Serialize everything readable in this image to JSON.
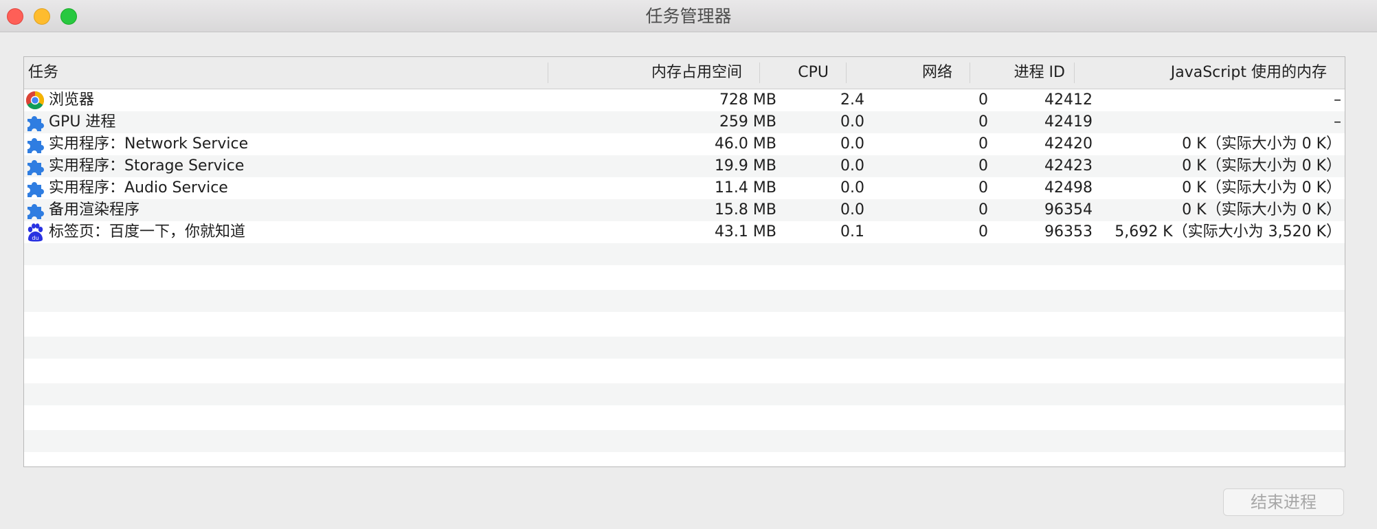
{
  "window": {
    "title": "任务管理器"
  },
  "table": {
    "columns": [
      {
        "key": "task",
        "label": "任务"
      },
      {
        "key": "memory",
        "label": "内存占用空间"
      },
      {
        "key": "cpu",
        "label": "CPU"
      },
      {
        "key": "network",
        "label": "网络"
      },
      {
        "key": "pid",
        "label": "进程 ID"
      },
      {
        "key": "js_memory",
        "label": "JavaScript 使用的内存"
      }
    ],
    "rows": [
      {
        "icon": "chrome-icon",
        "task": "浏览器",
        "memory": "728 MB",
        "cpu": "2.4",
        "network": "0",
        "pid": "42412",
        "js_memory": "–"
      },
      {
        "icon": "puzzle-icon",
        "task": "GPU 进程",
        "memory": "259 MB",
        "cpu": "0.0",
        "network": "0",
        "pid": "42419",
        "js_memory": "–"
      },
      {
        "icon": "puzzle-icon",
        "task": "实用程序：Network Service",
        "memory": "46.0 MB",
        "cpu": "0.0",
        "network": "0",
        "pid": "42420",
        "js_memory": "0 K（实际大小为 0 K）"
      },
      {
        "icon": "puzzle-icon",
        "task": "实用程序：Storage Service",
        "memory": "19.9 MB",
        "cpu": "0.0",
        "network": "0",
        "pid": "42423",
        "js_memory": "0 K（实际大小为 0 K）"
      },
      {
        "icon": "puzzle-icon",
        "task": "实用程序：Audio Service",
        "memory": "11.4 MB",
        "cpu": "0.0",
        "network": "0",
        "pid": "42498",
        "js_memory": "0 K（实际大小为 0 K）"
      },
      {
        "icon": "puzzle-icon",
        "task": "备用渲染程序",
        "memory": "15.8 MB",
        "cpu": "0.0",
        "network": "0",
        "pid": "96354",
        "js_memory": "0 K（实际大小为 0 K）"
      },
      {
        "icon": "baidu-paw-icon",
        "task": "标签页：百度一下，你就知道",
        "memory": "43.1 MB",
        "cpu": "0.1",
        "network": "0",
        "pid": "96353",
        "js_memory": "5,692 K（实际大小为 3,520 K）"
      }
    ]
  },
  "footer": {
    "end_process_label": "结束进程"
  },
  "colors": {
    "puzzle_blue": "#2f7de1",
    "baidu_blue": "#2932e1",
    "row_stripe": "#f4f5f5",
    "disabled_text": "#a7a7a7"
  }
}
